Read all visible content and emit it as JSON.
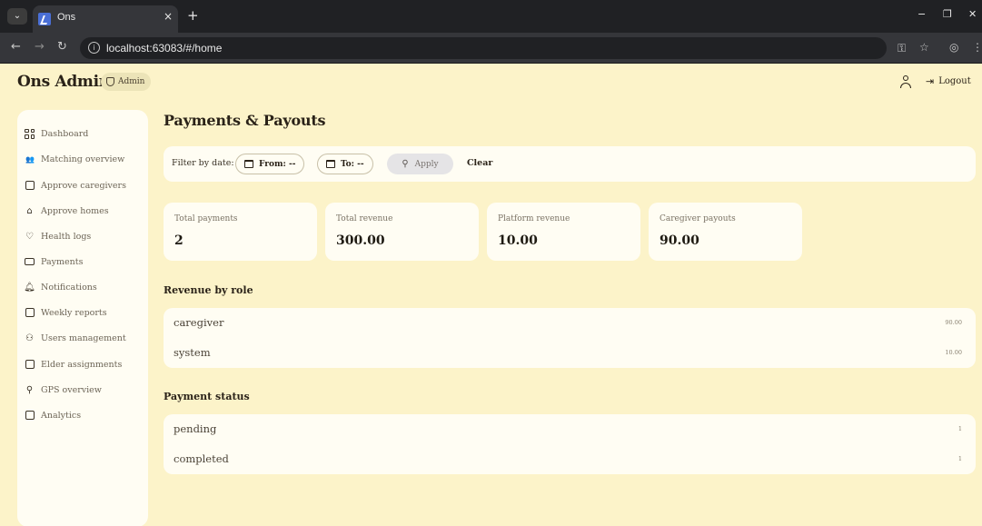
{
  "browser": {
    "tab_title": "Ons",
    "tab_close": "×",
    "new_tab": "+",
    "url": "localhost:63083/#/home",
    "controls": {
      "minimize": "−",
      "restore": "❐",
      "close": "✕"
    }
  },
  "header": {
    "brand": "Ons Admin",
    "role_badge": "Admin",
    "logout_label": "Logout"
  },
  "sidebar": {
    "items": [
      {
        "label": "Dashboard",
        "icon": "dashboard-grid-icon"
      },
      {
        "label": "Matching overview",
        "icon": "people-group-icon"
      },
      {
        "label": "Approve caregivers",
        "icon": "id-badge-icon"
      },
      {
        "label": "Approve homes",
        "icon": "home-icon"
      },
      {
        "label": "Health logs",
        "icon": "heart-icon"
      },
      {
        "label": "Payments",
        "icon": "payments-icon"
      },
      {
        "label": "Notifications",
        "icon": "bell-icon"
      },
      {
        "label": "Weekly reports",
        "icon": "report-icon"
      },
      {
        "label": "Users management",
        "icon": "users-icon"
      },
      {
        "label": "Elder assignments",
        "icon": "assignment-icon"
      },
      {
        "label": "GPS overview",
        "icon": "location-pin-icon"
      },
      {
        "label": "Analytics",
        "icon": "analytics-icon"
      }
    ]
  },
  "main": {
    "title": "Payments & Payouts",
    "filter": {
      "label": "Filter by date:",
      "from_label": "From: --",
      "to_label": "To: --",
      "apply_label": "Apply",
      "clear_label": "Clear"
    },
    "stats": [
      {
        "label": "Total payments",
        "value": "2"
      },
      {
        "label": "Total revenue",
        "value": "300.00"
      },
      {
        "label": "Platform revenue",
        "value": "10.00"
      },
      {
        "label": "Caregiver payouts",
        "value": "90.00"
      }
    ],
    "revenue_by_role": {
      "title": "Revenue by role",
      "rows": [
        {
          "label": "caregiver",
          "value": "90.00"
        },
        {
          "label": "system",
          "value": "10.00"
        }
      ]
    },
    "payment_status": {
      "title": "Payment status",
      "rows": [
        {
          "label": "pending",
          "value": "1"
        },
        {
          "label": "completed",
          "value": "1"
        }
      ]
    }
  }
}
